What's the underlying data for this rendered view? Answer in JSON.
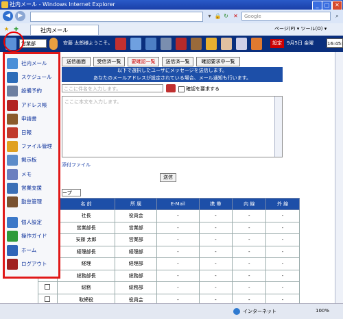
{
  "window": {
    "title": "社内メール - Windows Internet Explorer",
    "min": "_",
    "max": "□",
    "close": "✕"
  },
  "browser": {
    "url": "",
    "search_placeholder": "Google",
    "tab_label": "社内メール",
    "commands": "ページ(P) ▾  ツール(O) ▾"
  },
  "header": {
    "dept": "営業部",
    "greeting": "安藤 太郎様ようこそ。",
    "settings_label": "設定",
    "date": "9月5日 金曜",
    "time": "16:45:1"
  },
  "tabs": [
    "送信画面",
    "受信済一覧",
    "要確認一覧",
    "送信済一覧",
    "確認要求中一覧"
  ],
  "info": [
    "以下で選択したユーザにメッセージを送信します。",
    "あなたのメールアドレスが設定されている場合、メール通知も行います。"
  ],
  "compose": {
    "subject_placeholder": "ここに件名を入力します。",
    "confirm_label": "確認を要求する",
    "body_placeholder": "ここに本文を入力します。",
    "attach_label": "添付ファイル",
    "send_label": "送信",
    "group_select": "ープ"
  },
  "menu": [
    {
      "label": "社内メール",
      "icon": "mail-icon",
      "color": "#4a8fd8"
    },
    {
      "label": "スケジュール",
      "icon": "calendar-icon",
      "color": "#2c6cb8"
    },
    {
      "label": "設備予約",
      "icon": "facility-icon",
      "color": "#6d7fa0"
    },
    {
      "label": "アドレス帳",
      "icon": "addressbook-icon",
      "color": "#b22222"
    },
    {
      "label": "申請書",
      "icon": "application-icon",
      "color": "#8b5a2b"
    },
    {
      "label": "日報",
      "icon": "report-icon",
      "color": "#c0392b"
    },
    {
      "label": "ファイル管理",
      "icon": "folder-icon",
      "color": "#e0a020"
    },
    {
      "label": "掲示板",
      "icon": "board-icon",
      "color": "#5d8cc9"
    },
    {
      "label": "メモ",
      "icon": "memo-icon",
      "color": "#6b7fbf"
    },
    {
      "label": "営業支援",
      "icon": "sales-icon",
      "color": "#3b6fb6"
    },
    {
      "label": "勤怠管理",
      "icon": "attendance-icon",
      "color": "#7a5230"
    },
    {
      "label": "個人設定",
      "icon": "user-settings-icon",
      "color": "#3c78c8"
    },
    {
      "label": "操作ガイド",
      "icon": "help-icon",
      "color": "#2f9a3a"
    },
    {
      "label": "ホーム",
      "icon": "home-icon",
      "color": "#2f64b8"
    },
    {
      "label": "ログアウト",
      "icon": "logout-icon",
      "color": "#a02020"
    }
  ],
  "table": {
    "headers": [
      "",
      "名 前",
      "所 属",
      "E-Mail",
      "携 帯",
      "内 線",
      "外 線"
    ],
    "rows": [
      [
        "",
        "社長",
        "役員会",
        "-",
        "-",
        "-",
        "-"
      ],
      [
        "",
        "営業部長",
        "営業部",
        "-",
        "-",
        "-",
        "-"
      ],
      [
        "",
        "安藤 太郎",
        "営業部",
        "-",
        "-",
        "-",
        "-"
      ],
      [
        "",
        "経理部長",
        "経理部",
        "-",
        "-",
        "-",
        "-"
      ],
      [
        "",
        "経理",
        "経理部",
        "-",
        "-",
        "-",
        "-"
      ],
      [
        "",
        "総務部長",
        "総務部",
        "-",
        "-",
        "-",
        "-"
      ],
      [
        "",
        "総務",
        "総務部",
        "-",
        "-",
        "-",
        "-"
      ],
      [
        "",
        "取締役",
        "役員会",
        "-",
        "-",
        "-",
        "-"
      ]
    ]
  },
  "status": {
    "zone": "インターネット",
    "zoom": "100%"
  }
}
